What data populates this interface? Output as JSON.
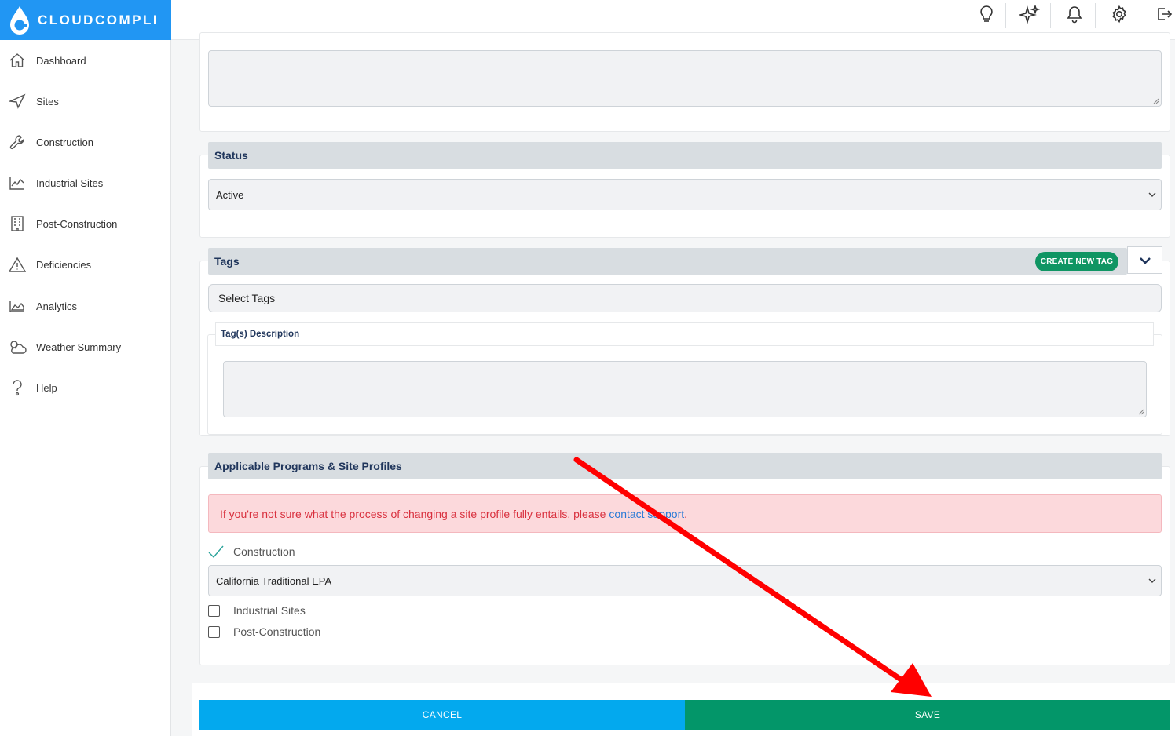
{
  "brand": {
    "name": "CLOUDCOMPLI"
  },
  "sidebar": {
    "items": [
      {
        "label": "Dashboard"
      },
      {
        "label": "Sites"
      },
      {
        "label": "Construction"
      },
      {
        "label": "Industrial Sites"
      },
      {
        "label": "Post-Construction"
      },
      {
        "label": "Deficiencies"
      },
      {
        "label": "Analytics"
      },
      {
        "label": "Weather Summary"
      },
      {
        "label": "Help"
      }
    ]
  },
  "topbar": {
    "icons": [
      "lightbulb-icon",
      "sparkle-icon",
      "bell-icon",
      "gear-icon",
      "logout-icon"
    ]
  },
  "status": {
    "header": "Status",
    "selected": "Active"
  },
  "tags": {
    "header": "Tags",
    "create_label": "CREATE NEW TAG",
    "select_placeholder": "Select Tags",
    "description_label": "Tag(s) Description"
  },
  "programs": {
    "header": "Applicable Programs & Site Profiles",
    "alert_text": "If you're not sure what the process of changing a site profile fully entails, please",
    "alert_link": "contact support",
    "alert_end": ".",
    "construction_label": "Construction",
    "construction_profile": "California Traditional EPA",
    "industrial_label": "Industrial Sites",
    "post_construction_label": "Post-Construction"
  },
  "actions": {
    "cancel_label": "CANCEL",
    "save_label": "SAVE"
  },
  "colors": {
    "brand_blue": "#2196f3",
    "cancel_blue": "#03a9ee",
    "save_green": "#039669",
    "tag_green": "#0f9563",
    "header_navy": "#20365c",
    "alert_red": "#d9303e",
    "annotation_arrow": "#ff0000"
  }
}
